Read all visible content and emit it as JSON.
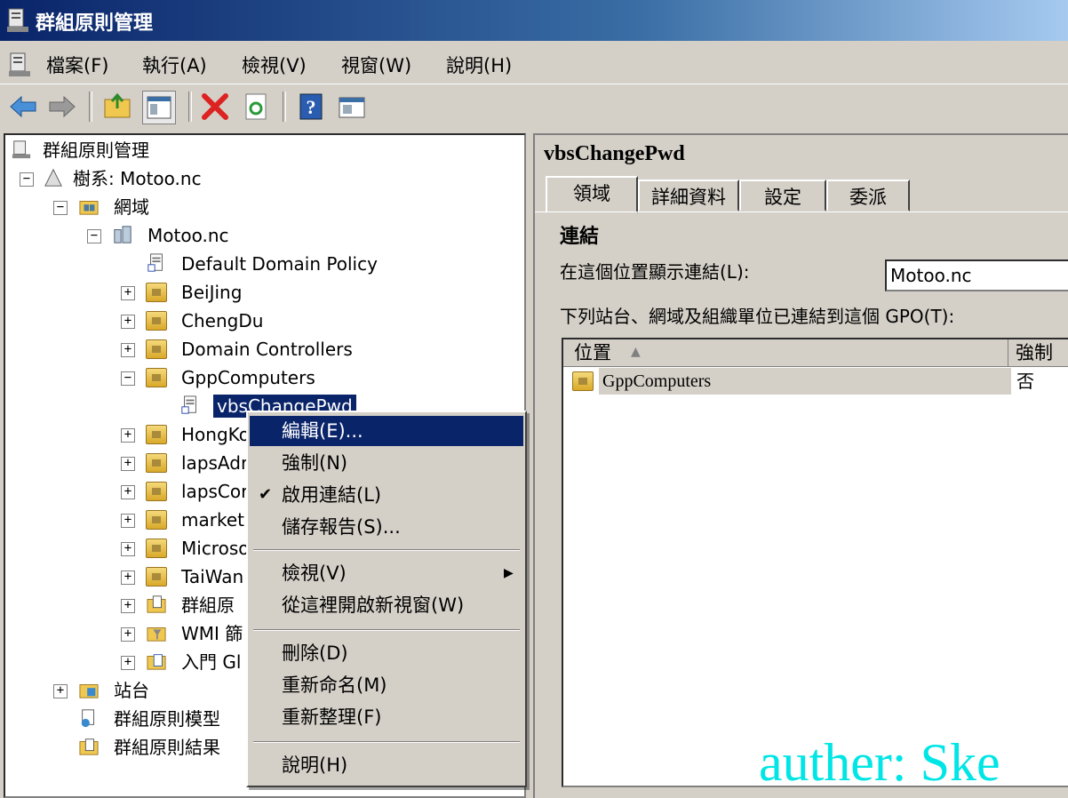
{
  "window": {
    "title": "群組原則管理"
  },
  "menu": {
    "items": [
      "檔案(F)",
      "執行(A)",
      "檢視(V)",
      "視窗(W)",
      "說明(H)"
    ]
  },
  "toolbar": {
    "buttons": [
      "back-arrow-icon",
      "forward-arrow-icon",
      "up-folder-icon",
      "show-hide-tree-icon",
      "delete-icon",
      "refresh-icon",
      "help-icon",
      "properties-icon"
    ]
  },
  "tree": {
    "root": "群組原則管理",
    "forest": "樹系: Motoo.nc",
    "domains": "網域",
    "domain": "Motoo.nc",
    "items": [
      "Default Domain Policy",
      "BeiJing",
      "ChengDu",
      "Domain Controllers",
      "GppComputers",
      "vbsChangePwd",
      "HongKo",
      "lapsAdr",
      "lapsCor",
      "market",
      "Microso",
      "TaiWan",
      "群組原",
      "WMI 篩",
      "入門 Gl"
    ],
    "sites": "站台",
    "modeling": "群組原則模型",
    "results": "群組原則結果"
  },
  "context_menu": {
    "items": [
      "編輯(E)...",
      "強制(N)",
      "啟用連結(L)",
      "儲存報告(S)...",
      "檢視(V)",
      "從這裡開啟新視窗(W)",
      "刪除(D)",
      "重新命名(M)",
      "重新整理(F)",
      "說明(H)"
    ],
    "checked_item": "啟用連結(L)"
  },
  "details": {
    "title": "vbsChangePwd",
    "tabs": [
      "領域",
      "詳細資料",
      "設定",
      "委派"
    ],
    "section": "連結",
    "location_label": "在這個位置顯示連結(L):",
    "location_value": "Motoo.nc",
    "linked_label": "下列站台、網域及組織單位已連結到這個 GPO(T):",
    "columns": [
      "位置",
      "強制"
    ],
    "rows": [
      {
        "location": "GppComputers",
        "enforced": "否"
      }
    ]
  },
  "watermark": "auther: Ske",
  "colors": {
    "titlebar": "#0a246a",
    "selection": "#0a246a",
    "watermark": "#00e5e5"
  }
}
